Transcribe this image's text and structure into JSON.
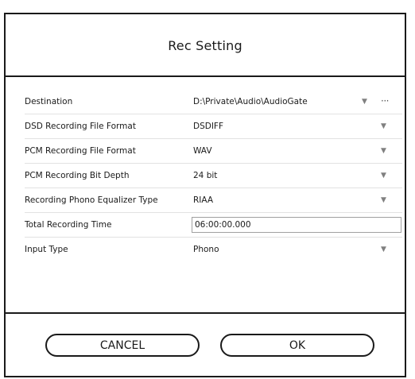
{
  "dialog": {
    "title": "Rec Setting"
  },
  "settings": {
    "destination": {
      "label": "Destination",
      "value": "D:\\Private\\Audio\\AudioGate",
      "arrow": "▼",
      "browse": "···"
    },
    "dsd_format": {
      "label": "DSD Recording File Format",
      "value": "DSDIFF",
      "arrow": "▼"
    },
    "pcm_format": {
      "label": "PCM Recording File Format",
      "value": "WAV",
      "arrow": "▼"
    },
    "pcm_bit_depth": {
      "label": "PCM Recording Bit Depth",
      "value": "24 bit",
      "arrow": "▼"
    },
    "phono_eq": {
      "label": "Recording Phono Equalizer Type",
      "value": "RIAA",
      "arrow": "▼"
    },
    "total_time": {
      "label": "Total Recording Time",
      "value": "06:00:00.000"
    },
    "input_type": {
      "label": "Input Type",
      "value": "Phono",
      "arrow": "▼"
    }
  },
  "buttons": {
    "cancel": "CANCEL",
    "ok": "OK"
  },
  "colors": {
    "border": "#1a1a1a",
    "row_divider": "#e2e2e2",
    "arrow": "#808080"
  }
}
